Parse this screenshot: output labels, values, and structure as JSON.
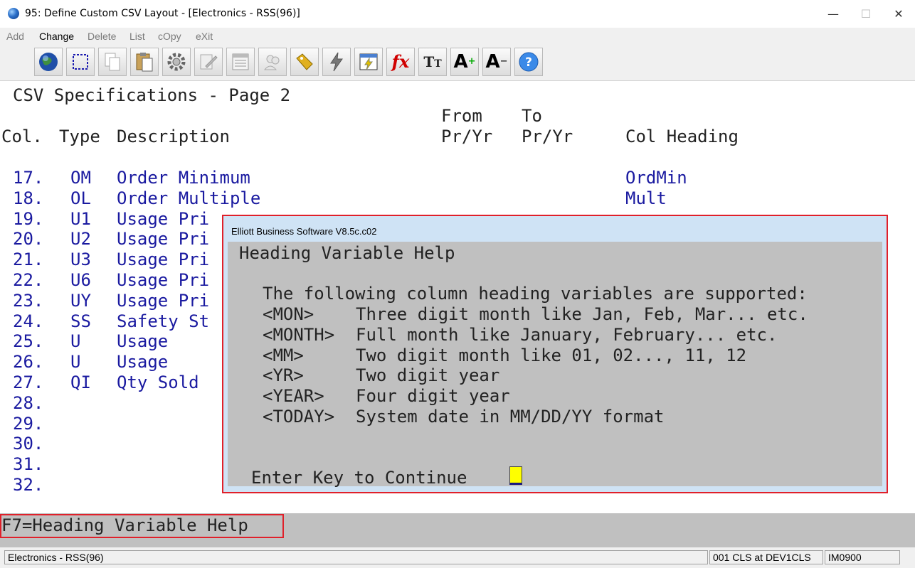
{
  "window": {
    "title": "95: Define Custom CSV Layout - [Electronics - RSS(96)]",
    "minimize": "—",
    "maximize": "☐",
    "close": "✕"
  },
  "menu": {
    "add": "Add",
    "change": "Change",
    "delete": "Delete",
    "list": "List",
    "copy": "cOpy",
    "exit": "eXit"
  },
  "toolbar": {
    "buttons": [
      {
        "name": "globe-icon",
        "glyph": ""
      },
      {
        "name": "select-area-icon",
        "glyph": "⬚"
      },
      {
        "name": "copy-icon",
        "glyph": "⎘"
      },
      {
        "name": "paste-icon",
        "glyph": "📋"
      },
      {
        "name": "gear-icon",
        "glyph": "⚙"
      },
      {
        "name": "edit-icon",
        "glyph": "✎"
      },
      {
        "name": "list-icon",
        "glyph": "☰"
      },
      {
        "name": "users-icon",
        "glyph": "👥"
      },
      {
        "name": "tag-icon",
        "glyph": "🏷"
      },
      {
        "name": "lightning-icon",
        "glyph": "⚡"
      },
      {
        "name": "calendar-icon",
        "glyph": "▦"
      },
      {
        "name": "function-icon",
        "glyph": "fx"
      },
      {
        "name": "text-size-icon",
        "glyph": "TT"
      },
      {
        "name": "font-increase-icon",
        "glyph": "A⁺"
      },
      {
        "name": "font-decrease-icon",
        "glyph": "A⁻"
      },
      {
        "name": "help-icon",
        "glyph": "?"
      }
    ]
  },
  "screen": {
    "page_title": "CSV Specifications - Page 2",
    "headers": {
      "from": "From",
      "to": "To",
      "col": "Col.",
      "type": "Type",
      "description": "Description",
      "from_pryr": "Pr/Yr",
      "to_pryr": "Pr/Yr",
      "col_heading": "Col Heading"
    },
    "rows": [
      {
        "num": "17.",
        "type": "OM",
        "desc": "Order Minimum",
        "heading": "OrdMin"
      },
      {
        "num": "18.",
        "type": "OL",
        "desc": "Order Multiple",
        "heading": "Mult"
      },
      {
        "num": "19.",
        "type": "U1",
        "desc": "Usage Pri",
        "heading": ""
      },
      {
        "num": "20.",
        "type": "U2",
        "desc": "Usage Pri",
        "heading": ""
      },
      {
        "num": "21.",
        "type": "U3",
        "desc": "Usage Pri",
        "heading": ""
      },
      {
        "num": "22.",
        "type": "U6",
        "desc": "Usage Pri",
        "heading": ""
      },
      {
        "num": "23.",
        "type": "UY",
        "desc": "Usage Pri",
        "heading": ""
      },
      {
        "num": "24.",
        "type": "SS",
        "desc": "Safety St",
        "heading": ""
      },
      {
        "num": "25.",
        "type": "U",
        "desc": "Usage",
        "heading": ""
      },
      {
        "num": "26.",
        "type": "U",
        "desc": "Usage",
        "heading": ""
      },
      {
        "num": "27.",
        "type": "QI",
        "desc": "Qty Sold",
        "heading": ""
      },
      {
        "num": "28.",
        "type": "",
        "desc": "",
        "heading": ""
      },
      {
        "num": "29.",
        "type": "",
        "desc": "",
        "heading": ""
      },
      {
        "num": "30.",
        "type": "",
        "desc": "",
        "heading": ""
      },
      {
        "num": "31.",
        "type": "",
        "desc": "",
        "heading": ""
      },
      {
        "num": "32.",
        "type": "",
        "desc": "",
        "heading": ""
      }
    ]
  },
  "popup": {
    "window_title": "Elliott Business Software V8.5c.c02",
    "heading": "Heading Variable Help",
    "intro": "The following column heading variables are supported:",
    "vars": [
      {
        "name": "<MON>",
        "desc": "Three digit month like Jan, Feb, Mar... etc."
      },
      {
        "name": "<MONTH>",
        "desc": "Full month like January, February... etc."
      },
      {
        "name": "<MM>",
        "desc": "Two digit month like 01, 02..., 11, 12"
      },
      {
        "name": "<YR>",
        "desc": "Two digit year"
      },
      {
        "name": "<YEAR>",
        "desc": "Four digit year"
      },
      {
        "name": "<TODAY>",
        "desc": "System date in MM/DD/YY format"
      }
    ],
    "prompt": "Enter Key to Continue"
  },
  "fkey": {
    "text": "F7=Heading Variable Help"
  },
  "status": {
    "company": "Electronics - RSS(96)",
    "session": "001 CLS at DEV1CLS",
    "program": "IM0900"
  },
  "colors": {
    "terminal_text": "#1a1aa0",
    "label_text": "#222222",
    "highlight_border": "#e0202a",
    "cursor": "#ffff00"
  }
}
